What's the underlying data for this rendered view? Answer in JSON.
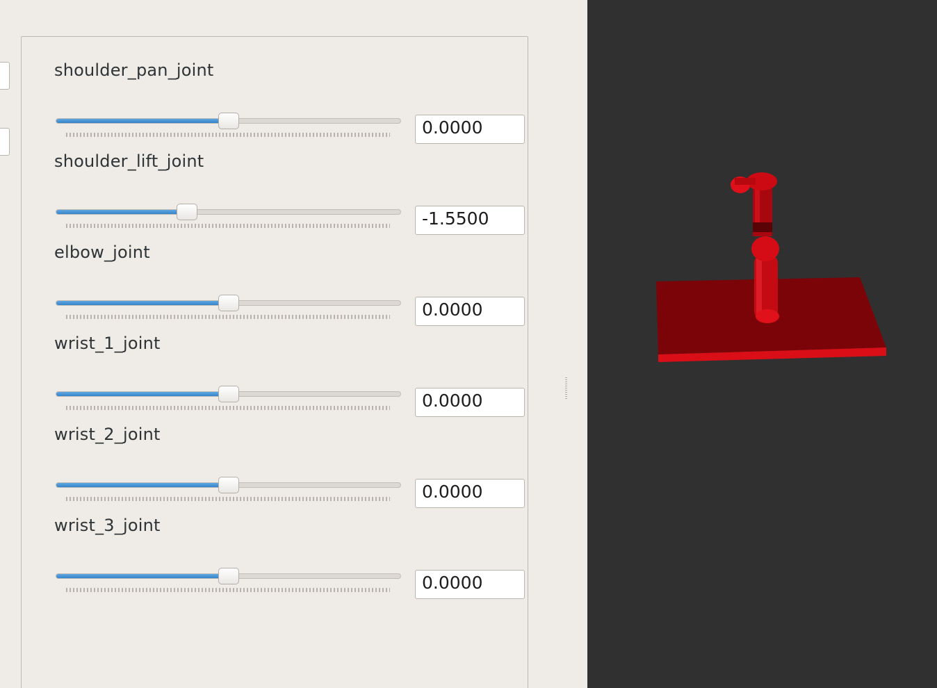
{
  "joints": [
    {
      "name": "shoulder_pan_joint",
      "value": "0.0000",
      "fraction": 0.5
    },
    {
      "name": "shoulder_lift_joint",
      "value": "-1.5500",
      "fraction": 0.38
    },
    {
      "name": "elbow_joint",
      "value": "0.0000",
      "fraction": 0.5
    },
    {
      "name": "wrist_1_joint",
      "value": "0.0000",
      "fraction": 0.5
    },
    {
      "name": "wrist_2_joint",
      "value": "0.0000",
      "fraction": 0.5
    },
    {
      "name": "wrist_3_joint",
      "value": "0.0000",
      "fraction": 0.5
    }
  ],
  "colors": {
    "slider_accent": "#3d8fd5",
    "robot_model": "#d0101a",
    "viewport_background": "#303030"
  }
}
